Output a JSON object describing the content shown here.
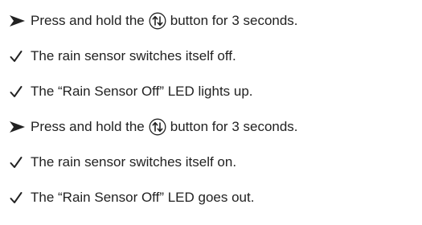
{
  "steps": [
    {
      "bullet": "arrow-icon",
      "before": "Press and hold the",
      "icon": "up-down-arrows-button-icon",
      "after": "button for 3 seconds."
    },
    {
      "bullet": "check-icon",
      "text": "The rain sensor switches itself off."
    },
    {
      "bullet": "check-icon",
      "text": "The “Rain Sensor Off” LED lights up."
    },
    {
      "bullet": "arrow-icon",
      "before": "Press and hold the",
      "icon": "up-down-arrows-button-icon",
      "after": "button for 3 seconds."
    },
    {
      "bullet": "check-icon",
      "text": "The rain sensor switches itself on."
    },
    {
      "bullet": "check-icon",
      "text": "The “Rain Sensor Off” LED goes out."
    }
  ]
}
